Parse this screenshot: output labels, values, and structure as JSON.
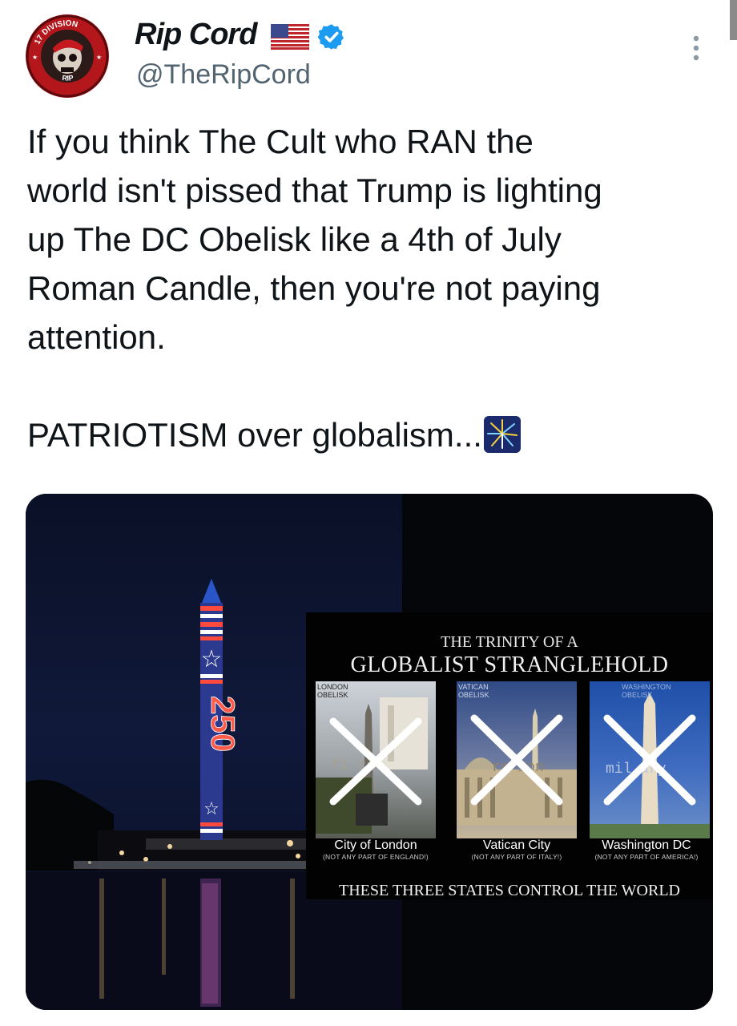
{
  "author": {
    "display_name": "Rip Cord",
    "handle": "@TheRipCord",
    "avatar_text_top": "17 DIVISION",
    "avatar_text_bottom": "RIP"
  },
  "tweet": {
    "text": "If you think The Cult who RAN the\nworld isn't pissed that Trump is lighting\nup The DC Obelisk like a 4th of July\nRoman Candle, then you're not paying\nattention.\n\nPATRIOTISM over globalism...",
    "trailing_emoji": "fireworks-icon"
  },
  "media": {
    "monument_text": "250",
    "panel": {
      "subtitle": "THE TRINITY OF A",
      "title": "GLOBALIST STRANGLEHOLD",
      "tiles": [
        {
          "caption": "LONDON\nOBELISK",
          "city": "City of London",
          "note": "(NOT ANY PART OF ENGLAND!)",
          "overlay": "fi  ce"
        },
        {
          "caption": "VATICAN\nOBELISK",
          "city": "Vatican City",
          "note": "(NOT ANY PART OF ITALY!)",
          "overlay": "re   ion"
        },
        {
          "caption": "WASHINGTON\nOBELISK",
          "city": "Washington DC",
          "note": "(NOT ANY PART OF AMERICA!)",
          "overlay": "mil  ary"
        }
      ],
      "footer": "THESE THREE STATES CONTROL THE WORLD"
    }
  },
  "colors": {
    "verified": "#1d9bf0",
    "handle": "#536471",
    "text": "#0f1419"
  }
}
